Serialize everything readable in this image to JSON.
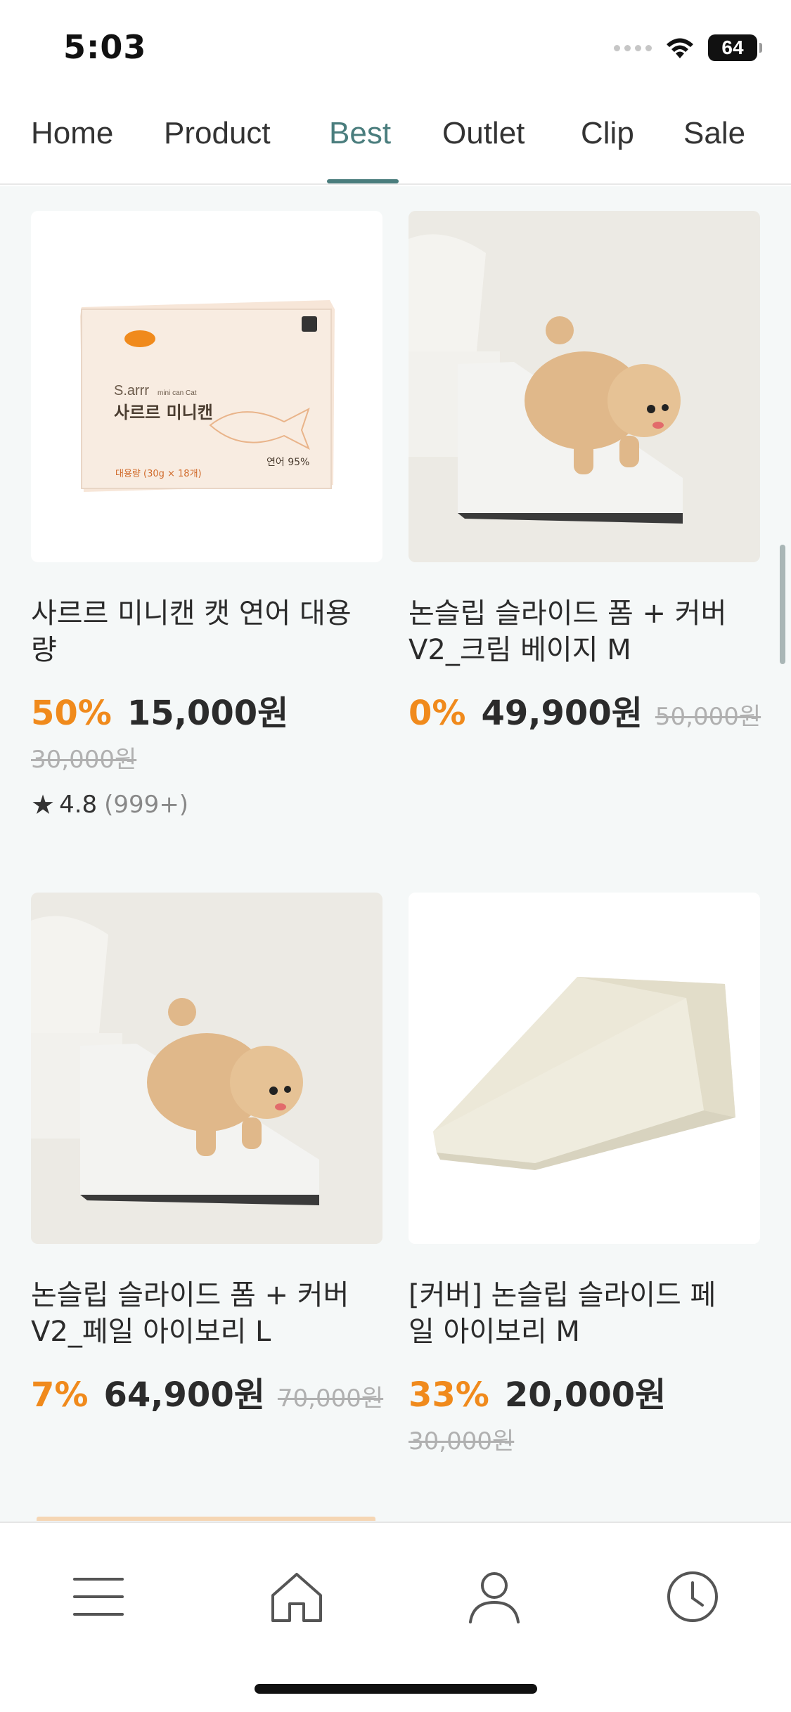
{
  "status_bar": {
    "time": "5:03",
    "battery": "64",
    "icons": [
      "signal-dots-icon",
      "wifi-icon",
      "battery-icon"
    ]
  },
  "nav": {
    "tabs": [
      {
        "label": "Home",
        "active": false
      },
      {
        "label": "Product",
        "active": false
      },
      {
        "label": "Best",
        "active": true
      },
      {
        "label": "Outlet",
        "active": false
      },
      {
        "label": "Clip",
        "active": false
      },
      {
        "label": "Sale",
        "active": false
      }
    ],
    "active_color": "#4a7d7d"
  },
  "products": [
    {
      "title_line1": "사르르 미니캔 캣 연어 대용",
      "title_line2": "량",
      "discount": "50%",
      "price": "15,000원",
      "original_price": "30,000원",
      "rating": "4.8",
      "review_count": "(999+)",
      "package_text": {
        "brand": "S.arrr",
        "sub": "mini can Cat",
        "name": "사르르 미니캔",
        "size": "대용량 (30g × 18개)",
        "flavor": "연어 95%"
      }
    },
    {
      "title_line1": "논슬립 슬라이드 폼 + 커버",
      "title_line2": "V2_크림 베이지 M",
      "discount": "0%",
      "price": "49,900원",
      "original_price": "50,000원"
    },
    {
      "title_line1": "논슬립 슬라이드 폼 + 커버",
      "title_line2": "V2_페일 아이보리 L",
      "discount": "7%",
      "price": "64,900원",
      "original_price": "70,000원"
    },
    {
      "title_line1": "[커버] 논슬립 슬라이드 페",
      "title_line2": "일 아이보리 M",
      "discount": "33%",
      "price": "20,000원",
      "original_price": "30,000원"
    }
  ],
  "colors": {
    "discount": "#f08a1c",
    "price": "#2b2b2b",
    "original_price": "#b0b0b0",
    "content_bg": "#f5f8f8"
  },
  "bottom_nav": {
    "icons": [
      "menu-icon",
      "home-icon",
      "profile-icon",
      "clock-icon"
    ]
  }
}
